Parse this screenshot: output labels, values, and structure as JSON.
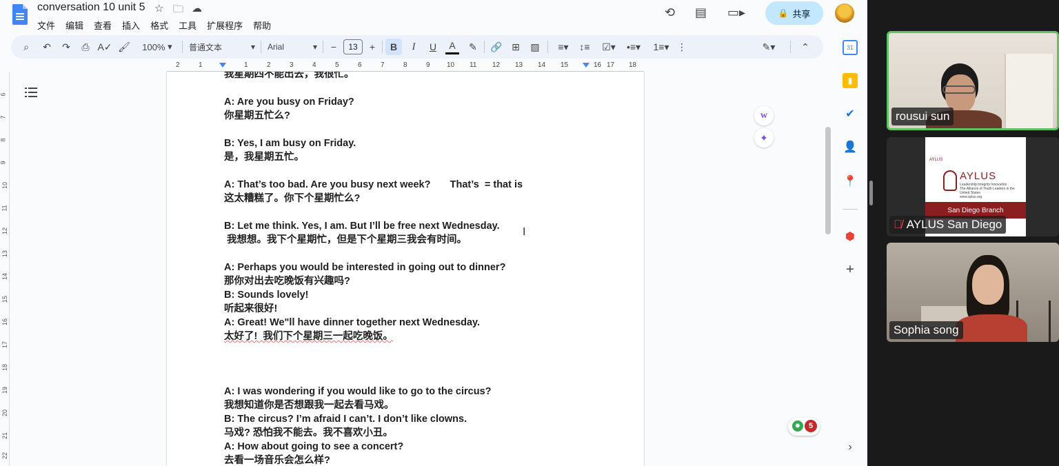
{
  "doc": {
    "title": "conversation 10 unit 5",
    "menu": [
      "文件",
      "编辑",
      "查看",
      "插入",
      "格式",
      "工具",
      "扩展程序",
      "帮助"
    ],
    "share_label": "共享"
  },
  "toolbar": {
    "zoom": "100%",
    "style": "普通文本",
    "font": "Arial",
    "font_size": "13",
    "bold": "B",
    "italic": "I",
    "underline": "U",
    "text_color": "A"
  },
  "ruler": {
    "numbers": [
      "2",
      "1",
      "1",
      "2",
      "3",
      "4",
      "5",
      "6",
      "7",
      "8",
      "9",
      "10",
      "11",
      "12",
      "13",
      "14",
      "15",
      "16",
      "17",
      "18"
    ]
  },
  "vertical_ruler": {
    "numbers": [
      "6",
      "7",
      "8",
      "9",
      "10",
      "11",
      "12",
      "13",
      "14",
      "15",
      "16",
      "17",
      "18",
      "19",
      "20",
      "21",
      "22"
    ]
  },
  "content": {
    "lines": [
      "我星期四不能出去，我很忙。",
      "A: Are you busy on Friday?",
      "你星期五忙么?",
      "B: Yes, I am busy on Friday.",
      "是，我星期五忙。",
      "A: That’s too bad. Are you busy next week?       That’s  = that is",
      "这太糟糕了。你下个星期忙么?",
      "B: Let me think. Yes, I am. But I’ll be free next Wednesday.",
      " 我想想。我下个星期忙，但是下个星期三我会有时间。",
      "A: Perhaps you would be interested in going out to dinner?",
      "那你对出去吃晚饭有兴趣吗?",
      "B: Sounds lovely!",
      "听起来很好!",
      "A: Great! We\"ll have dinner together next Wednesday.",
      "太好了!  我们下个星期三一起吃晚饭。",
      "A: I was wondering if you would like to go to the circus?",
      "我想知道你是否想跟我一起去看马戏。",
      "B: The circus? I’m afraid I can’t. I don’t like clowns.",
      "马戏? 恐怕我不能去。我不喜欢小丑。",
      "A: How about going to see a concert?",
      "去看一场音乐会怎么样?"
    ]
  },
  "badge": {
    "count": "5"
  },
  "zoom": {
    "participants": [
      {
        "name": "rousui sun"
      },
      {
        "name": "AYLUS San Diego"
      },
      {
        "name": "Sophia song"
      }
    ],
    "aylus_card": {
      "top": "AYLUS",
      "title": "AYLUS",
      "subtitle": "Leadership Integrity Innovation",
      "alliance": "The Alliance of Youth Leaders in the United States",
      "url": "www.aylus.org",
      "branch": "San Diego Branch"
    }
  },
  "colors": {
    "accent": "#4285f4",
    "share_bg": "#c2e7ff",
    "active_speaker": "#5ec463",
    "aylus_red": "#8b1e1e"
  }
}
